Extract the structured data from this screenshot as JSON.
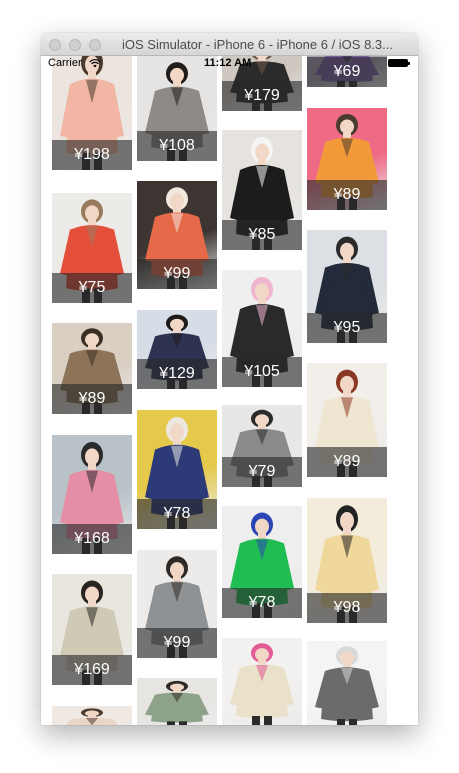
{
  "window": {
    "title": "iOS Simulator - iPhone 6 - iPhone 6 / iOS 8.3..."
  },
  "status_bar": {
    "carrier": "Carrier",
    "time": "11:12 AM"
  },
  "product_grid": {
    "columns": [
      {
        "items": [
          {
            "price": "¥198",
            "colors": {
              "bg": "#ece4df",
              "garment": "#f2b7a4",
              "accent": "#4b3a2e"
            }
          },
          {
            "price": "¥75",
            "colors": {
              "bg": "#ecebe8",
              "garment": "#e4503c",
              "accent": "#9a7a5c"
            }
          },
          {
            "price": "¥89",
            "colors": {
              "bg": "#d9cfc3",
              "garment": "#8d7358",
              "accent": "#3d2e23"
            }
          },
          {
            "price": "¥168",
            "colors": {
              "bg": "#b8c2c8",
              "garment": "#e58fa6",
              "accent": "#2b2b2b"
            }
          },
          {
            "price": "¥169",
            "colors": {
              "bg": "#e9e6df",
              "garment": "#cfcab6",
              "accent": "#2a2420"
            }
          },
          {
            "price": "",
            "colors": {
              "bg": "#efe8e3",
              "garment": "#e9d6c8",
              "accent": "#4e3b2f"
            }
          }
        ]
      },
      {
        "items": [
          {
            "price": "¥108",
            "colors": {
              "bg": "#e6e4e2",
              "garment": "#8e8a86",
              "accent": "#1f1c1a"
            }
          },
          {
            "price": "¥99",
            "colors": {
              "bg": "#3d3531",
              "garment": "#e66a4a",
              "accent": "#f2e8de"
            }
          },
          {
            "price": "¥129",
            "colors": {
              "bg": "#d7dde6",
              "garment": "#2d3250",
              "accent": "#1d1a19"
            }
          },
          {
            "price": "¥78",
            "colors": {
              "bg": "#e4c94a",
              "garment": "#2c3a78",
              "accent": "#ece8e0"
            }
          },
          {
            "price": "¥99",
            "colors": {
              "bg": "#ecebea",
              "garment": "#8f9294",
              "accent": "#2f2a27"
            }
          },
          {
            "price": "",
            "colors": {
              "bg": "#e7e5e2",
              "garment": "#8ea28a",
              "accent": "#2f2a27"
            }
          }
        ]
      },
      {
        "items": [
          {
            "price": "¥179",
            "colors": {
              "bg": "#cfc8c0",
              "garment": "#2b2b2b",
              "accent": "#6f5a48"
            }
          },
          {
            "price": "¥85",
            "colors": {
              "bg": "#e6e3df",
              "garment": "#1c1c1c",
              "accent": "#f5f5f5"
            }
          },
          {
            "price": "¥105",
            "colors": {
              "bg": "#efefef",
              "garment": "#2a2a2a",
              "accent": "#f1b6cf"
            }
          },
          {
            "price": "¥79",
            "colors": {
              "bg": "#e8e7e5",
              "garment": "#8a8a8a",
              "accent": "#2a2a2a"
            }
          },
          {
            "price": "¥78",
            "colors": {
              "bg": "#eeeeee",
              "garment": "#1fbd52",
              "accent": "#2b46b4"
            }
          },
          {
            "price": "",
            "colors": {
              "bg": "#f3f1ef",
              "garment": "#e9e1c9",
              "accent": "#e25b96"
            }
          }
        ]
      },
      {
        "items": [
          {
            "price": "¥69",
            "colors": {
              "bg": "#a9a3b4",
              "garment": "#7a5fa8",
              "accent": "#2b2b2b"
            }
          },
          {
            "price": "¥89",
            "colors": {
              "bg": "#ef6a84",
              "garment": "#f29a3a",
              "accent": "#4b3a2e"
            }
          },
          {
            "price": "¥95",
            "colors": {
              "bg": "#dcdfe3",
              "garment": "#232a3a",
              "accent": "#2a2a2a"
            }
          },
          {
            "price": "¥89",
            "colors": {
              "bg": "#f2eeea",
              "garment": "#efe6d2",
              "accent": "#8a3a24"
            }
          },
          {
            "price": "¥98",
            "colors": {
              "bg": "#f4ecdb",
              "garment": "#f0d79c",
              "accent": "#222222"
            }
          },
          {
            "price": "",
            "colors": {
              "bg": "#f4f4f4",
              "garment": "#6b6b6b",
              "accent": "#d8d8d8"
            }
          }
        ]
      }
    ]
  }
}
